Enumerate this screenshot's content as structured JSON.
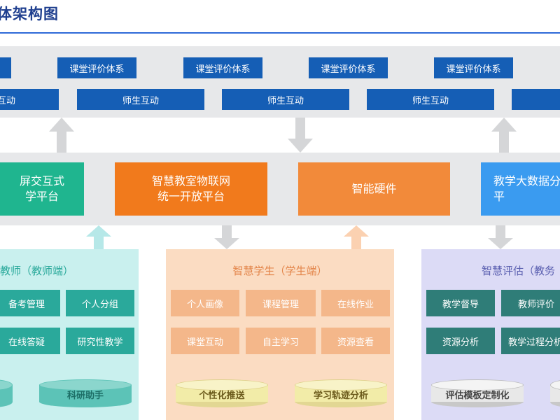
{
  "title": "体架构图",
  "eval_row": [
    "",
    "课堂评价体系",
    "课堂评价体系",
    "课堂评价体系",
    "课堂评价体系"
  ],
  "interaction_row": [
    "互动",
    "师生互动",
    "师生互动",
    "师生互动",
    ""
  ],
  "platforms": [
    {
      "label": "屏交互式\n学平台",
      "color": "#1fb58f"
    },
    {
      "label": "智慧教室物联网\n统一开放平台",
      "color": "#f17a1c"
    },
    {
      "label": "智能硬件",
      "color": "#f28a3a"
    },
    {
      "label": "教学大数据分\n平",
      "color": "#3a9bf0"
    }
  ],
  "panels": {
    "teacher": {
      "title": "教师（教师端）",
      "cells": [
        "备考管理",
        "个人分组",
        "在线答疑",
        "研究性教学"
      ],
      "cylinders": [
        "",
        "科研助手"
      ]
    },
    "student": {
      "title": "智慧学生（学生端）",
      "cells": [
        "个人画像",
        "课程管理",
        "在线作业",
        "课堂互动",
        "自主学习",
        "资源查看"
      ],
      "cylinders": [
        "个性化推送",
        "学习轨迹分析"
      ]
    },
    "evaluation": {
      "title": "智慧评估（教务",
      "cells": [
        "教学督导",
        "教师评价",
        "资源分析",
        "教学过程分析"
      ],
      "cylinders": [
        "评估模板定制化",
        ""
      ]
    }
  },
  "colors": {
    "title": "#1f3f8f",
    "blue_button": "#155eb5",
    "band": "#e7e8ea",
    "teacher_panel": "#c9f0ee",
    "teacher_cell": "#2aa99b",
    "student_panel": "#fbdcc2",
    "student_cell": "#f4b78a",
    "eval_panel": "#dcdbf6",
    "eval_cell": "#2f7d78",
    "arrow_gray": "#d5d6d8",
    "arrow_teal": "#b6e8e8",
    "arrow_peach": "#fbd1b1"
  }
}
